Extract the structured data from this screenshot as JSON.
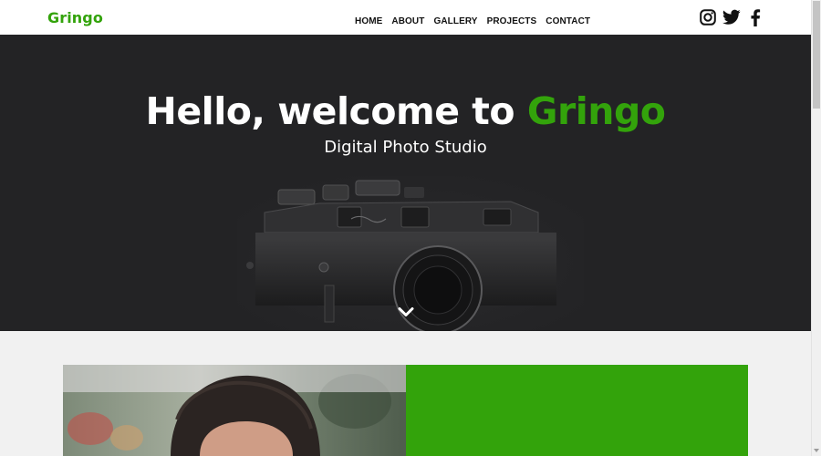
{
  "navbar": {
    "brand": "Gringo",
    "menu": [
      {
        "label": "HOME"
      },
      {
        "label": "ABOUT"
      },
      {
        "label": "GALLERY"
      },
      {
        "label": "PROJECTS"
      },
      {
        "label": "CONTACT"
      }
    ],
    "social": [
      {
        "icon": "instagram-icon"
      },
      {
        "icon": "twitter-icon"
      },
      {
        "icon": "facebook-icon"
      }
    ]
  },
  "hero": {
    "title_main": "Hello, welcome to ",
    "title_accent": "Gringo",
    "subtitle": "Digital Photo Studio",
    "camera_image": "vintage-camera-image",
    "scroll_icon": "chevron-down-icon"
  },
  "content": {
    "photo": "portrait-photo",
    "panel": "green-panel"
  },
  "colors": {
    "accent": "#33a30b",
    "hero_bg": "#232325",
    "nav_bg": "#ffffff",
    "page_bg": "#f1f1f1"
  }
}
